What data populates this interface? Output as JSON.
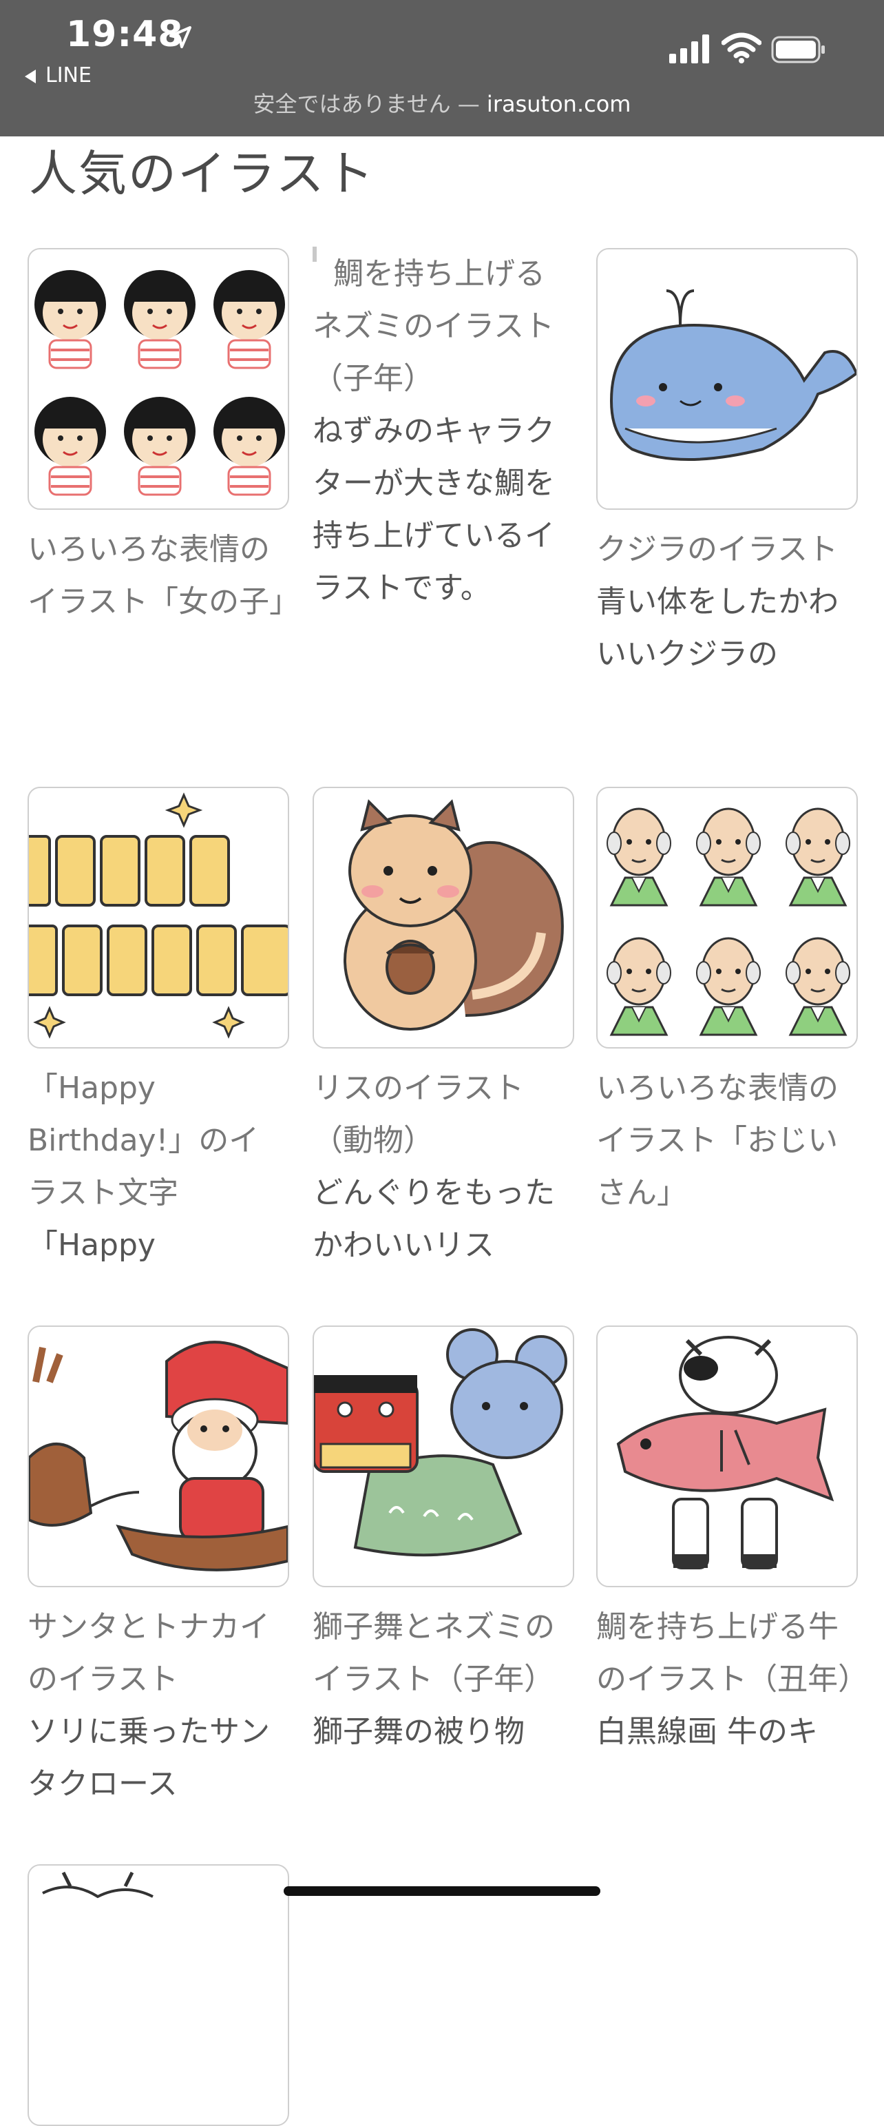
{
  "status": {
    "time": "19:48",
    "back_app": "LINE",
    "insecure_label": "安全ではありません — ",
    "domain": "irasuton.com"
  },
  "section_title": "人気のイラスト",
  "cards": [
    {
      "title": "いろいろな表情のイラスト「女の子」",
      "desc": ""
    },
    {
      "title": "鯛を持ち上げるネズミのイラスト（子年）",
      "desc": "ねずみのキャラクターが大きな鯛を持ち上げているイラストです。"
    },
    {
      "title": "クジラのイラスト",
      "desc": "青い体をしたかわいいクジラの"
    },
    {
      "title": "「Happy Birthday!」のイラスト文字",
      "desc": "「Happy"
    },
    {
      "title": "リスのイラスト（動物）",
      "desc": "どんぐりをもったかわいいリス"
    },
    {
      "title": "いろいろな表情のイラスト「おじいさん」",
      "desc": ""
    },
    {
      "title": "サンタとトナカイのイラスト",
      "desc": "ソリに乗ったサンタクロース"
    },
    {
      "title": "獅子舞とネズミのイラスト（子年）",
      "desc": "獅子舞の被り物"
    },
    {
      "title": "鯛を持ち上げる牛のイラスト（丑年）",
      "desc": "白黒線画 牛のキ"
    }
  ],
  "icons": {
    "location": "location-arrow-icon",
    "signal": "cellular-signal-icon",
    "wifi": "wifi-icon",
    "battery": "battery-icon"
  }
}
